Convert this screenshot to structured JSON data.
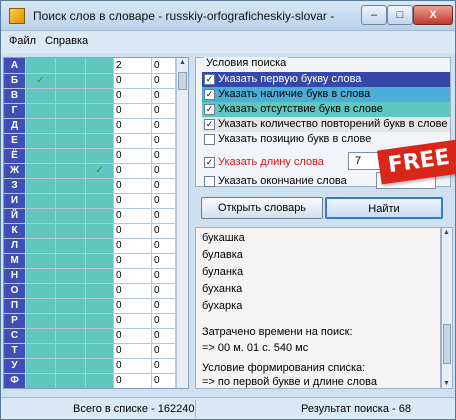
{
  "window": {
    "title": "Поиск слов в словаре - russkiy-orfograficheskiy-slovar -",
    "min_label": "–",
    "max_label": "□",
    "close_label": "X"
  },
  "menu": {
    "file": "Файл",
    "help": "Справка"
  },
  "grid": {
    "rows": [
      {
        "letter": "А",
        "a": "",
        "b": "",
        "c": "",
        "n1": "2",
        "n2": "0"
      },
      {
        "letter": "Б",
        "a": "✓",
        "b": "",
        "c": "",
        "n1": "0",
        "n2": "0"
      },
      {
        "letter": "В",
        "a": "",
        "b": "",
        "c": "",
        "n1": "0",
        "n2": "0"
      },
      {
        "letter": "Г",
        "a": "",
        "b": "",
        "c": "",
        "n1": "0",
        "n2": "0"
      },
      {
        "letter": "Д",
        "a": "",
        "b": "",
        "c": "",
        "n1": "0",
        "n2": "0"
      },
      {
        "letter": "Е",
        "a": "",
        "b": "",
        "c": "",
        "n1": "0",
        "n2": "0"
      },
      {
        "letter": "Ё",
        "a": "",
        "b": "",
        "c": "",
        "n1": "0",
        "n2": "0"
      },
      {
        "letter": "Ж",
        "a": "",
        "b": "",
        "c": "✓",
        "n1": "0",
        "n2": "0"
      },
      {
        "letter": "З",
        "a": "",
        "b": "",
        "c": "",
        "n1": "0",
        "n2": "0"
      },
      {
        "letter": "И",
        "a": "",
        "b": "",
        "c": "",
        "n1": "0",
        "n2": "0"
      },
      {
        "letter": "Й",
        "a": "",
        "b": "",
        "c": "",
        "n1": "0",
        "n2": "0"
      },
      {
        "letter": "К",
        "a": "",
        "b": "",
        "c": "",
        "n1": "0",
        "n2": "0"
      },
      {
        "letter": "Л",
        "a": "",
        "b": "",
        "c": "",
        "n1": "0",
        "n2": "0"
      },
      {
        "letter": "М",
        "a": "",
        "b": "",
        "c": "",
        "n1": "0",
        "n2": "0"
      },
      {
        "letter": "Н",
        "a": "",
        "b": "",
        "c": "",
        "n1": "0",
        "n2": "0"
      },
      {
        "letter": "О",
        "a": "",
        "b": "",
        "c": "",
        "n1": "0",
        "n2": "0"
      },
      {
        "letter": "П",
        "a": "",
        "b": "",
        "c": "",
        "n1": "0",
        "n2": "0"
      },
      {
        "letter": "Р",
        "a": "",
        "b": "",
        "c": "",
        "n1": "0",
        "n2": "0"
      },
      {
        "letter": "С",
        "a": "",
        "b": "",
        "c": "",
        "n1": "0",
        "n2": "0"
      },
      {
        "letter": "Т",
        "a": "",
        "b": "",
        "c": "",
        "n1": "0",
        "n2": "0"
      },
      {
        "letter": "У",
        "a": "",
        "b": "",
        "c": "",
        "n1": "0",
        "n2": "0"
      },
      {
        "letter": "Ф",
        "a": "",
        "b": "",
        "c": "",
        "n1": "0",
        "n2": "0"
      }
    ]
  },
  "conditions": {
    "legend": "Условия поиска",
    "options": [
      {
        "label": "Указать первую букву слова",
        "checked": "✓"
      },
      {
        "label": "Указать наличие букв в слова",
        "checked": "✓"
      },
      {
        "label": "Указать отсутствие букв в слове",
        "checked": "✓"
      },
      {
        "label": "Указать количество повторений букв в слове",
        "checked": "✓"
      },
      {
        "label": "Указать позицию букв в слове",
        "checked": ""
      },
      {
        "label": "Указать длину слова",
        "checked": "✓"
      },
      {
        "label": "Указать окончание слова",
        "checked": ""
      }
    ],
    "length_value": "7",
    "select_arrow": "▼"
  },
  "badge": "FREE",
  "buttons": {
    "open": "Открыть словарь",
    "find": "Найти"
  },
  "results": {
    "lines": [
      "букашка",
      "булавка",
      "буланка",
      "буханка",
      "бухарка"
    ],
    "time_label": "Затрачено времени на поиск:",
    "time_value": "=> 00 м. 01 с. 540 мс",
    "cond_label": "Условие формирования списка:",
    "cond_value": "=> по первой букве и длине слова"
  },
  "status": {
    "total": "Всего в списке - 162240",
    "found": "Результат поиска  - 68"
  }
}
